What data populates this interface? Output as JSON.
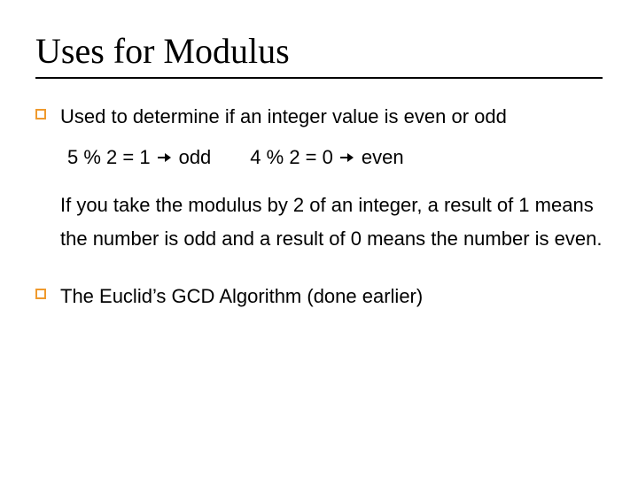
{
  "title": "Uses for Modulus",
  "bullets": [
    {
      "text": "Used to determine if an integer value is even or odd",
      "examples": [
        {
          "expr": "5 % 2 = 1",
          "result": "odd"
        },
        {
          "expr": "4 % 2 = 0",
          "result": "even"
        }
      ],
      "explain": "If you take the modulus by 2 of an integer, a result of 1 means the number is odd and a result of 0 means the number is even."
    },
    {
      "text": "The Euclid’s GCD Algorithm (done earlier)"
    }
  ]
}
